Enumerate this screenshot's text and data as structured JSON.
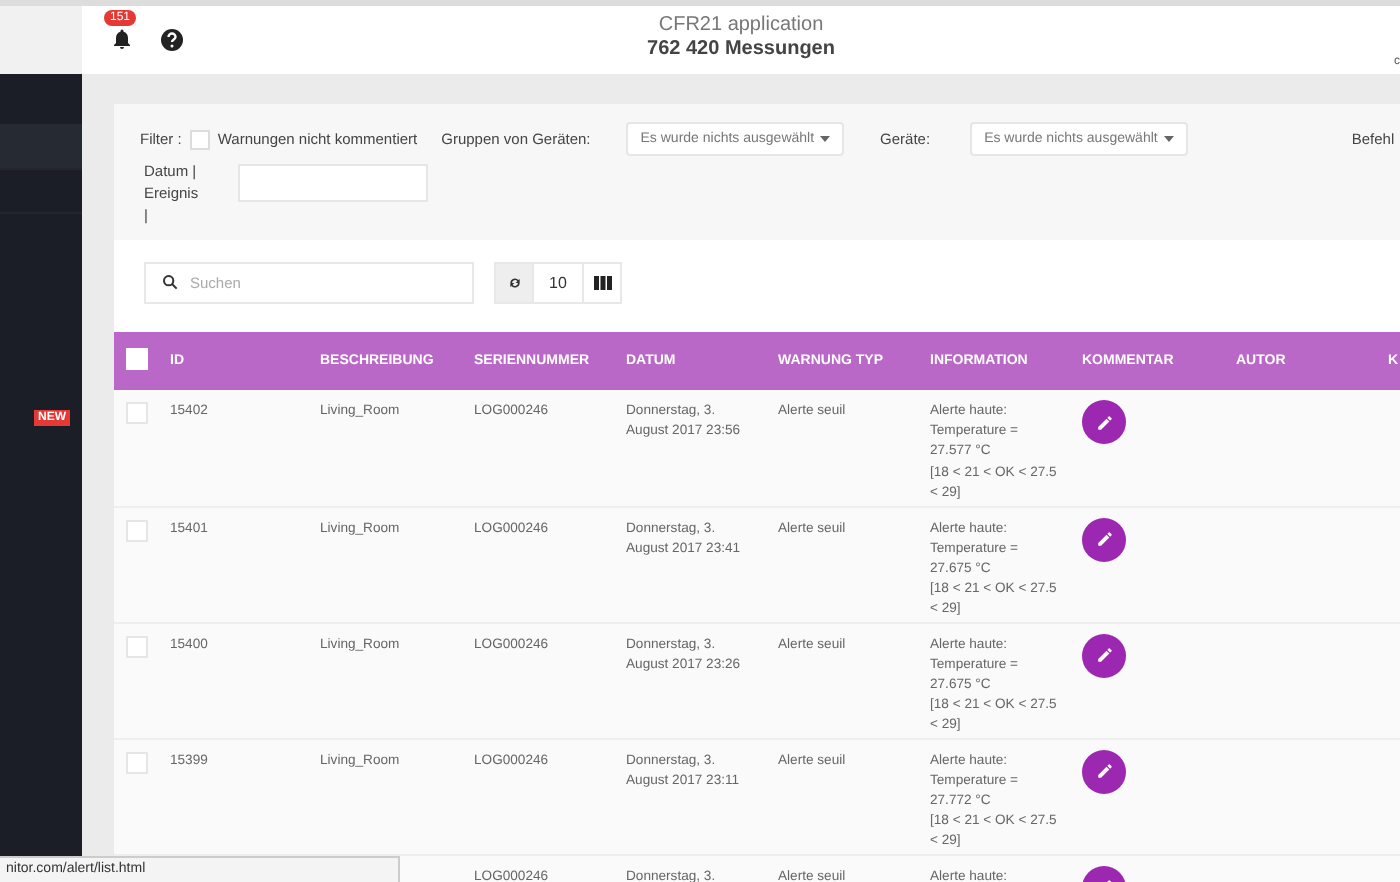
{
  "header": {
    "notification_count": "151",
    "title": "CFR21 application",
    "subtitle": "762 420 Messungen",
    "corner_text": "c"
  },
  "sidebar": {
    "items": [
      {
        "selected": true
      },
      {
        "selected": false
      }
    ],
    "badge": "NEW"
  },
  "filter": {
    "label": "Filter :",
    "uncommented_checkbox": {
      "label": "Warnungen nicht kommentiert",
      "checked": false
    },
    "groups_label": "Gruppen von Geräten:",
    "groups_dropdown": "Es wurde nichts ausgewählt",
    "devices_label": "Geräte:",
    "devices_dropdown": "Es wurde nichts ausgewählt",
    "command_label": "Befehl",
    "date_label": "Datum | Ereignis |"
  },
  "toolbar": {
    "search_placeholder": "Suchen",
    "page_size": "10"
  },
  "table": {
    "select_all": {
      "checked": false
    },
    "columns": [
      "ID",
      "BESCHREIBUNG",
      "SERIENNUMMER",
      "DATUM",
      "WARNUNG TYP",
      "INFORMATION",
      "KOMMENTAR",
      "AUTOR",
      "K"
    ],
    "rows": [
      {
        "checked": false,
        "id": "15402",
        "description": "Living_Room",
        "serial": "LOG000246",
        "date": "Donnerstag, 3. August 2017 23:56",
        "type": "Alerte seuil",
        "information": [
          "Alerte haute:",
          "Temperature =",
          "27.577 °C",
          "[18 < 21 < OK < 27.5",
          "< 29]"
        ]
      },
      {
        "checked": false,
        "id": "15401",
        "description": "Living_Room",
        "serial": "LOG000246",
        "date": "Donnerstag, 3. August 2017 23:41",
        "type": "Alerte seuil",
        "information": [
          "Alerte haute:",
          "Temperature =",
          "27.675 °C",
          "[18 < 21 < OK < 27.5",
          "< 29]"
        ]
      },
      {
        "checked": false,
        "id": "15400",
        "description": "Living_Room",
        "serial": "LOG000246",
        "date": "Donnerstag, 3. August 2017 23:26",
        "type": "Alerte seuil",
        "information": [
          "Alerte haute:",
          "Temperature =",
          "27.675 °C",
          "[18 < 21 < OK < 27.5",
          "< 29]"
        ]
      },
      {
        "checked": false,
        "id": "15399",
        "description": "Living_Room",
        "serial": "LOG000246",
        "date": "Donnerstag, 3. August 2017 23:11",
        "type": "Alerte seuil",
        "information": [
          "Alerte haute:",
          "Temperature =",
          "27.772 °C",
          "[18 < 21 < OK < 27.5",
          "< 29]"
        ]
      },
      {
        "serial": "LOG000246",
        "date": "Donnerstag, 3.",
        "type": "Alerte seuil",
        "information": [
          "Alerte haute:"
        ]
      }
    ]
  },
  "status_bar": {
    "url": "nitor.com/alert/list.html"
  }
}
